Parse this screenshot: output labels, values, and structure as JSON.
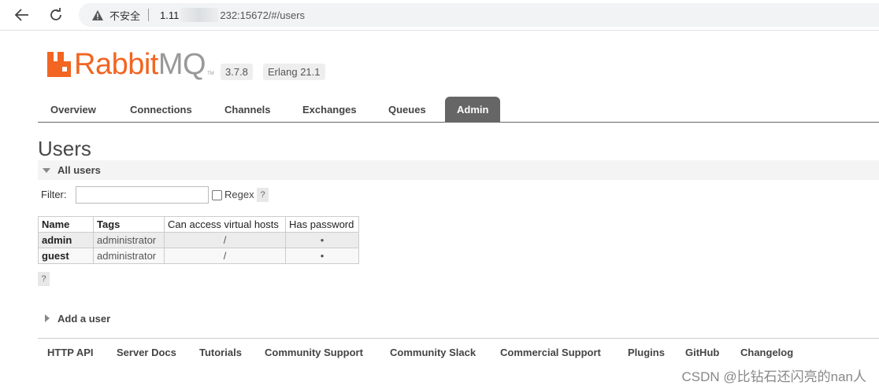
{
  "browser": {
    "security_label": "不安全",
    "url_host": "1.11",
    "url_rest": "232:15672/#/users"
  },
  "header": {
    "logo_rabbit": "Rabbit",
    "logo_mq": "MQ",
    "logo_tm": "TM",
    "version": "3.7.8",
    "erlang": "Erlang 21.1"
  },
  "tabs": [
    {
      "label": "Overview"
    },
    {
      "label": "Connections"
    },
    {
      "label": "Channels"
    },
    {
      "label": "Exchanges"
    },
    {
      "label": "Queues"
    },
    {
      "label": "Admin"
    }
  ],
  "page": {
    "title": "Users",
    "all_users": "All users",
    "filter_label": "Filter:",
    "filter_value": "",
    "regex_label": "Regex",
    "help": "?",
    "add_user": "Add a user"
  },
  "table": {
    "headers": [
      "Name",
      "Tags",
      "Can access virtual hosts",
      "Has password"
    ],
    "rows": [
      {
        "name": "admin",
        "tags": "administrator",
        "vhosts": "/",
        "has_password": "•"
      },
      {
        "name": "guest",
        "tags": "administrator",
        "vhosts": "/",
        "has_password": "•"
      }
    ]
  },
  "footer": {
    "links": [
      "HTTP API",
      "Server Docs",
      "Tutorials",
      "Community Support",
      "Community Slack",
      "Commercial Support",
      "Plugins",
      "GitHub",
      "Changelog"
    ]
  },
  "watermark": "CSDN @比钻石还闪亮的nan人",
  "colors": {
    "brand_orange": "#f26522",
    "tab_active_bg": "#666666"
  }
}
